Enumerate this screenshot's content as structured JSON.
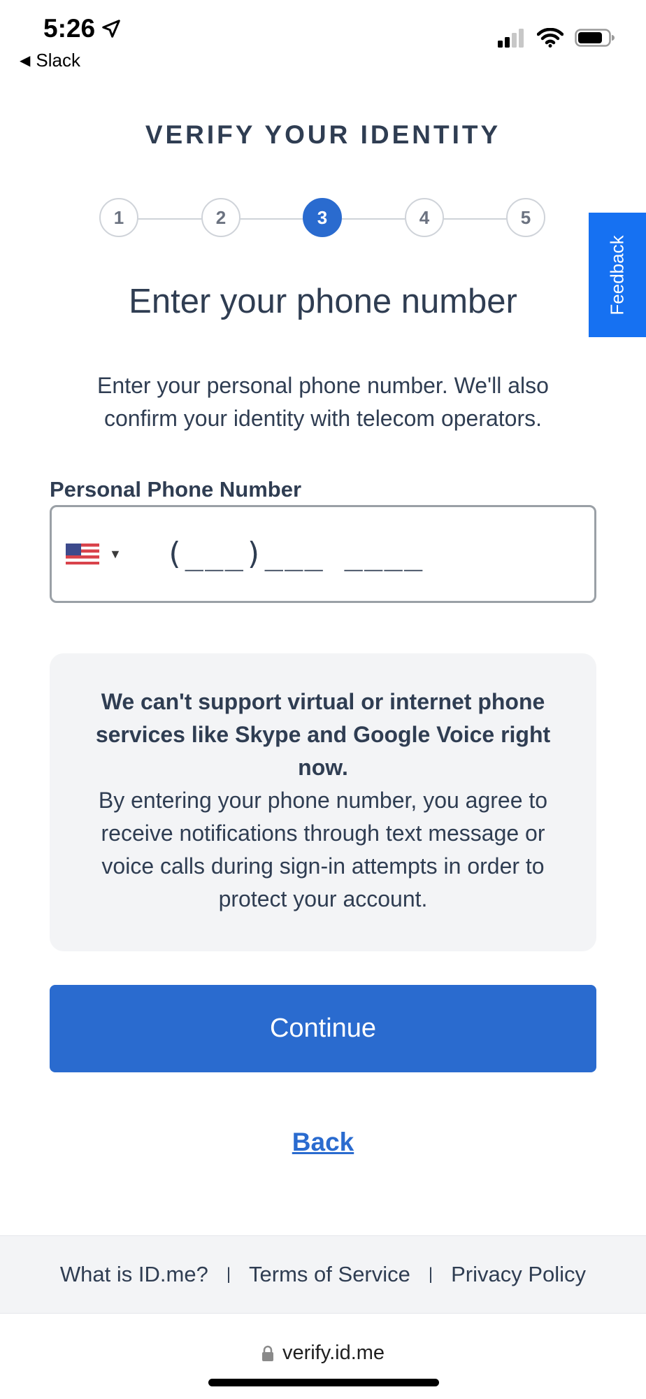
{
  "status_bar": {
    "time": "5:26",
    "back_app": "Slack"
  },
  "header": {
    "title": "VERIFY YOUR IDENTITY"
  },
  "stepper": {
    "steps": [
      "1",
      "2",
      "3",
      "4",
      "5"
    ],
    "active_index": 2
  },
  "feedback": {
    "label": "Feedback"
  },
  "main": {
    "title": "Enter your phone number",
    "intro": "Enter your personal phone number. We'll also confirm your identity with telecom operators.",
    "phone_field": {
      "label": "Personal Phone Number",
      "placeholder": "(___)___ ____",
      "value": "",
      "country": "US"
    },
    "notice": {
      "bold": "We can't support virtual or internet phone services like Skype and Google Voice right now.",
      "text": "By entering your phone number, you agree to receive notifications through text message or voice calls during sign-in attempts in order to protect your account."
    },
    "continue_label": "Continue",
    "back_label": "Back"
  },
  "footer": {
    "links": [
      "What is ID.me?",
      "Terms of Service",
      "Privacy Policy"
    ],
    "separator": "|"
  },
  "browser": {
    "url": "verify.id.me"
  },
  "colors": {
    "primary": "#2a6bcf",
    "feedback": "#1671f2",
    "text": "#2f3d52",
    "notice_bg": "#f3f4f6"
  }
}
